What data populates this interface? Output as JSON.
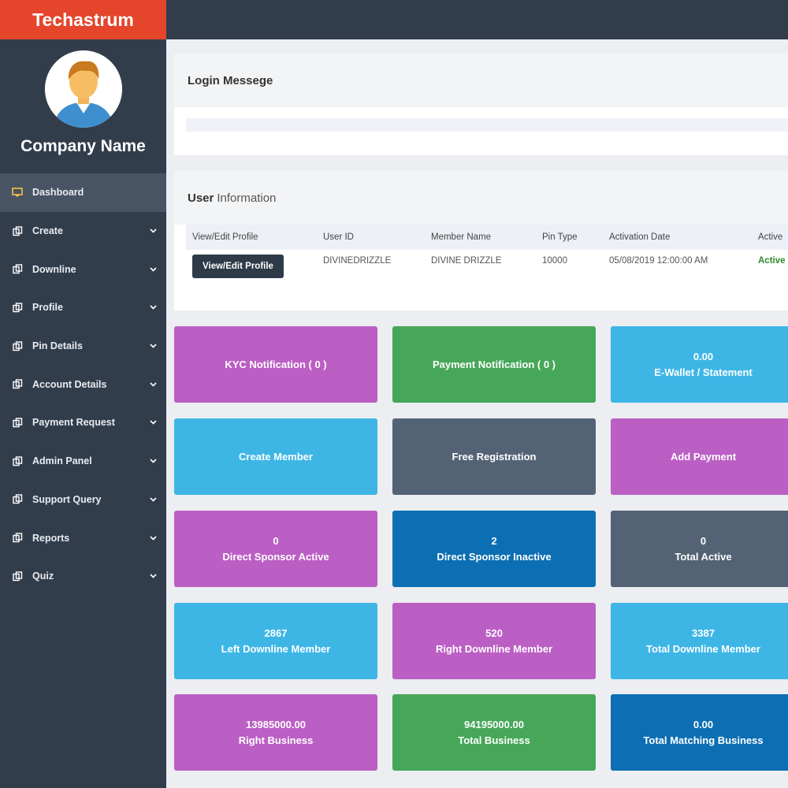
{
  "brand": {
    "name": "Techastrum",
    "color": "#e4452b"
  },
  "sidebar": {
    "company_name": "Company Name",
    "items": [
      {
        "label": "Dashboard",
        "icon": "monitor-icon",
        "active": true
      },
      {
        "label": "Create",
        "icon": "copy-icon"
      },
      {
        "label": "Downline",
        "icon": "copy-icon"
      },
      {
        "label": "Profile",
        "icon": "copy-icon"
      },
      {
        "label": "Pin Details",
        "icon": "copy-icon"
      },
      {
        "label": "Account Details",
        "icon": "copy-icon"
      },
      {
        "label": "Payment Request",
        "icon": "copy-icon"
      },
      {
        "label": "Admin Panel",
        "icon": "copy-icon"
      },
      {
        "label": "Support Query",
        "icon": "copy-icon"
      },
      {
        "label": "Reports",
        "icon": "copy-icon"
      },
      {
        "label": "Quiz",
        "icon": "copy-icon"
      }
    ]
  },
  "login_panel": {
    "title": "Login Messege"
  },
  "user_panel": {
    "title_bold": "User",
    "title_rest": "Information",
    "headers": [
      "View/Edit Profile",
      "User ID",
      "Member Name",
      "Pin Type",
      "Activation Date",
      "Active"
    ],
    "row": {
      "button_label": "View/Edit Profile",
      "user_id": "DIVINEDRIZZLE",
      "member_name": "DIVINE DRIZZLE",
      "pin_type": "10000",
      "activation_date": "05/08/2019 12:00:00 AM",
      "status": "Active"
    }
  },
  "tiles": [
    {
      "label": "KYC Notification ( 0 )",
      "color": "#bb5fc4"
    },
    {
      "label": "Payment Notification ( 0 )",
      "color": "#46a758"
    },
    {
      "value": "0.00",
      "label": "E-Wallet / Statement",
      "color": "#3db6e6"
    },
    {
      "label": "Create Member",
      "color": "#3db6e6"
    },
    {
      "label": "Free Registration",
      "color": "#536375"
    },
    {
      "label": "Add Payment",
      "color": "#bb5fc4"
    },
    {
      "value": "0",
      "label": "Direct Sponsor Active",
      "color": "#bb5fc4"
    },
    {
      "value": "2",
      "label": "Direct Sponsor Inactive",
      "color": "#0c6fb3"
    },
    {
      "value": "0",
      "label": "Total Active",
      "color": "#536375"
    },
    {
      "value": "2867",
      "label": "Left Downline Member",
      "color": "#3db6e6"
    },
    {
      "value": "520",
      "label": "Right Downline Member",
      "color": "#bb5fc4"
    },
    {
      "value": "3387",
      "label": "Total Downline Member",
      "color": "#3db6e6"
    },
    {
      "value": "13985000.00",
      "label": "Right Business",
      "color": "#bb5fc4"
    },
    {
      "value": "94195000.00",
      "label": "Total Business",
      "color": "#46a758"
    },
    {
      "value": "0.00",
      "label": "Total Matching Business",
      "color": "#0c6fb3"
    }
  ]
}
